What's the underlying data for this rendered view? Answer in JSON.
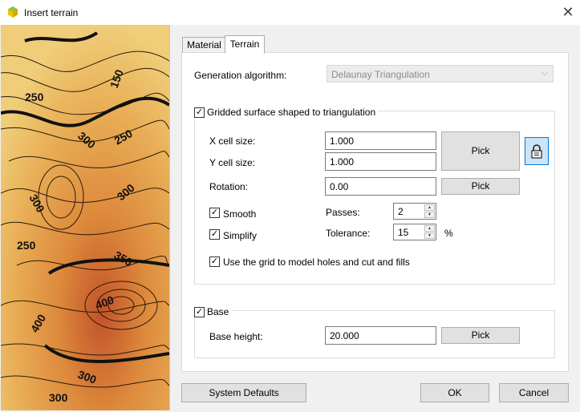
{
  "window": {
    "title": "Insert terrain",
    "close_glyph": "✕"
  },
  "tabs": [
    {
      "label": "Material"
    },
    {
      "label": "Terrain"
    }
  ],
  "terrain": {
    "generation_algorithm_label": "Generation algorithm:",
    "generation_algorithm_value": "Delaunay Triangulation",
    "gridded": {
      "label": "Gridded surface shaped to triangulation",
      "checked": true,
      "x_cell_label": "X cell size:",
      "x_cell_value": "1.000",
      "y_cell_label": "Y cell size:",
      "y_cell_value": "1.000",
      "pick_label": "Pick",
      "rotation_label": "Rotation:",
      "rotation_value": "0.00",
      "rotation_pick_label": "Pick",
      "smooth_label": "Smooth",
      "smooth_checked": true,
      "passes_label": "Passes:",
      "passes_value": "2",
      "simplify_label": "Simplify",
      "simplify_checked": true,
      "tolerance_label": "Tolerance:",
      "tolerance_value": "15",
      "tolerance_unit": "%",
      "use_grid_label": "Use the grid to model holes and cut and fills",
      "use_grid_checked": true
    },
    "base": {
      "label": "Base",
      "checked": true,
      "height_label": "Base height:",
      "height_value": "20.000",
      "pick_label": "Pick"
    }
  },
  "footer": {
    "system_defaults": "System Defaults",
    "ok": "OK",
    "cancel": "Cancel"
  },
  "map_labels": [
    "150",
    "250",
    "250",
    "300",
    "300",
    "350",
    "400",
    "400",
    "300",
    "250",
    "300",
    "300"
  ],
  "icons": {
    "app": "app-icon",
    "lock": "lock-icon",
    "check": "✓"
  }
}
